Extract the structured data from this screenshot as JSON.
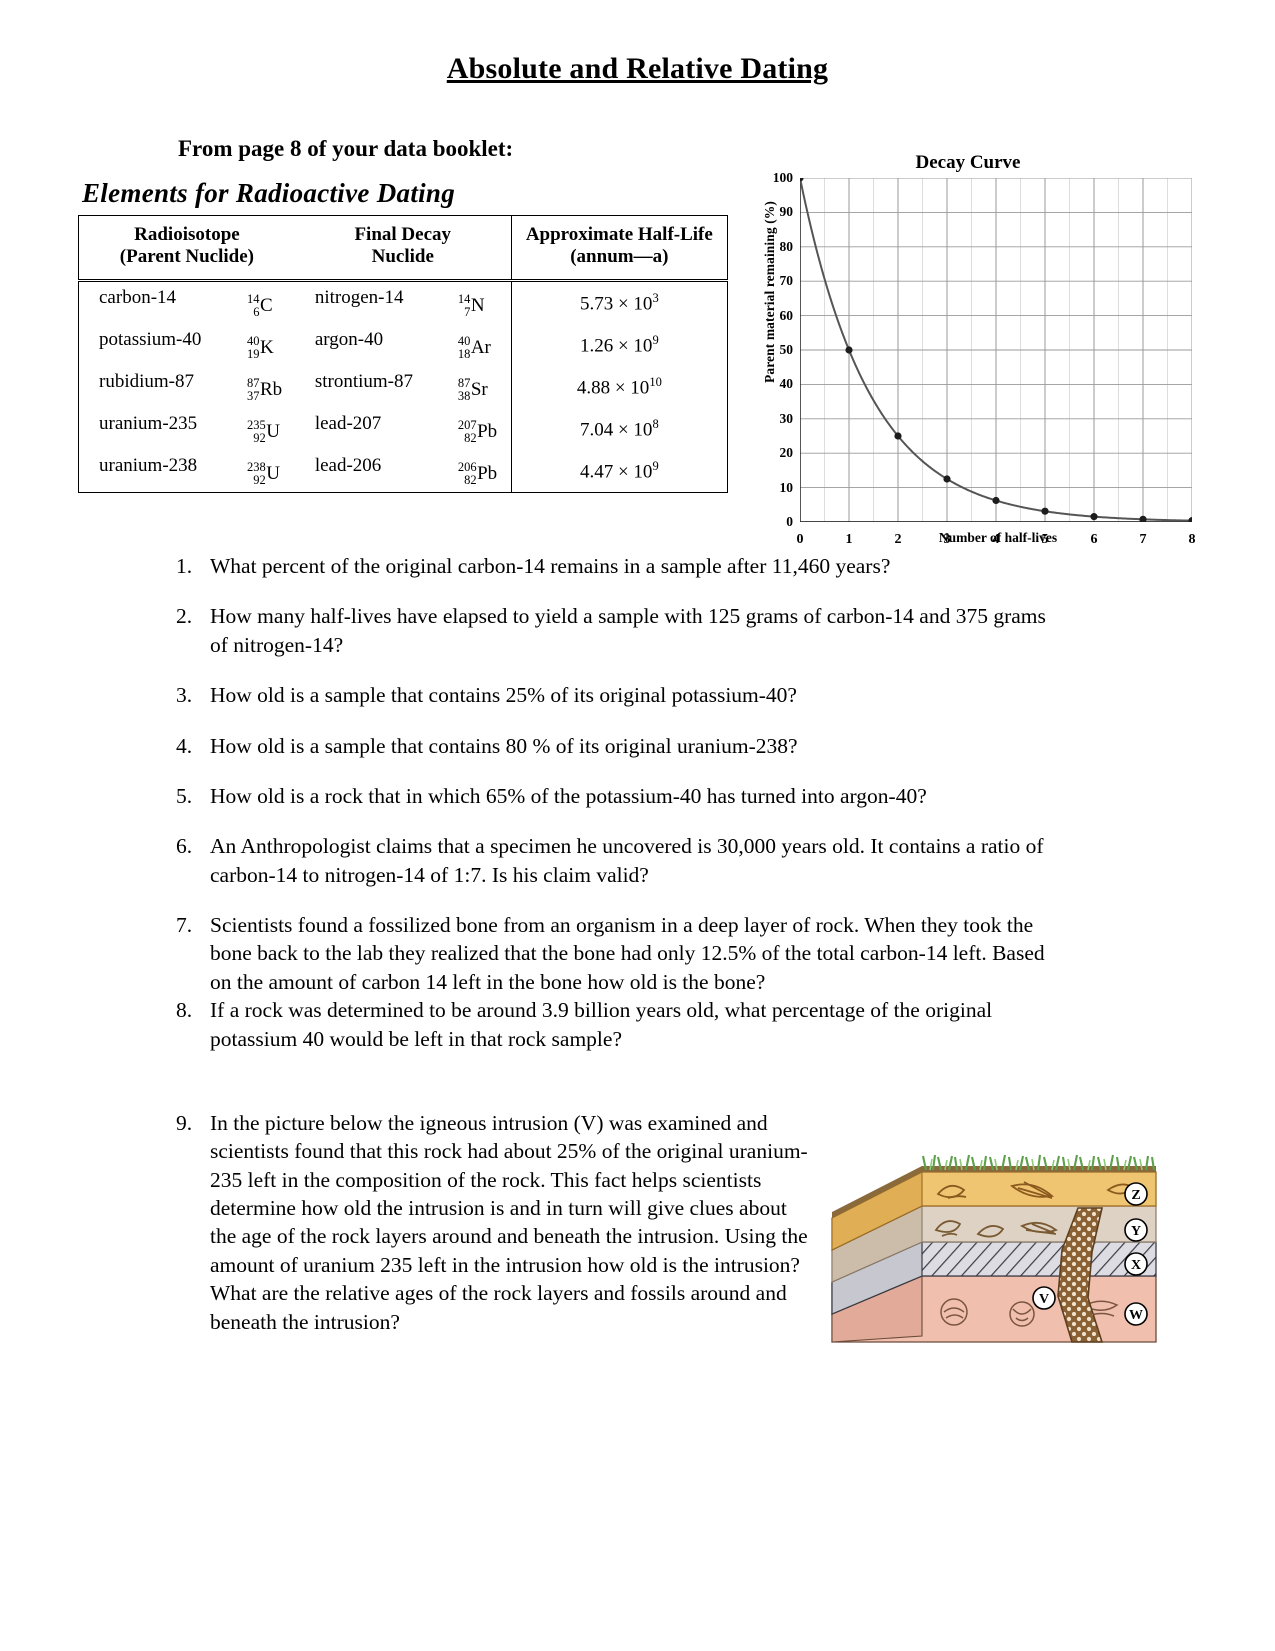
{
  "document": {
    "title": "Absolute and Relative Dating",
    "intro": "From page 8 of your data booklet:"
  },
  "booklet_table": {
    "caption": "Elements for Radioactive Dating",
    "headers": {
      "col1_line1": "Radioisotope",
      "col1_line2": "(Parent Nuclide)",
      "col2_line1": "Final Decay",
      "col2_line2": "Nuclide",
      "col3_line1": "Approximate Half-Life",
      "col3_line2": "(annum—a)"
    },
    "rows": [
      {
        "parent_name": "carbon-14",
        "parent_mass": "14",
        "parent_atomic": "6",
        "parent_symbol": "C",
        "daughter_name": "nitrogen-14",
        "daughter_mass": "14",
        "daughter_atomic": "7",
        "daughter_symbol": "N",
        "half_life_mantissa": "5.73",
        "half_life_exponent": "3",
        "half_life": "5.73 × 10³"
      },
      {
        "parent_name": "potassium-40",
        "parent_mass": "40",
        "parent_atomic": "19",
        "parent_symbol": "K",
        "daughter_name": "argon-40",
        "daughter_mass": "40",
        "daughter_atomic": "18",
        "daughter_symbol": "Ar",
        "half_life_mantissa": "1.26",
        "half_life_exponent": "9",
        "half_life": "1.26 × 10⁹"
      },
      {
        "parent_name": "rubidium-87",
        "parent_mass": "87",
        "parent_atomic": "37",
        "parent_symbol": "Rb",
        "daughter_name": "strontium-87",
        "daughter_mass": "87",
        "daughter_atomic": "38",
        "daughter_symbol": "Sr",
        "half_life_mantissa": "4.88",
        "half_life_exponent": "10",
        "half_life": "4.88 × 10¹⁰"
      },
      {
        "parent_name": "uranium-235",
        "parent_mass": "235",
        "parent_atomic": "92",
        "parent_symbol": "U",
        "daughter_name": "lead-207",
        "daughter_mass": "207",
        "daughter_atomic": "82",
        "daughter_symbol": "Pb",
        "half_life_mantissa": "7.04",
        "half_life_exponent": "8",
        "half_life": "7.04 × 10⁸"
      },
      {
        "parent_name": "uranium-238",
        "parent_mass": "238",
        "parent_atomic": "92",
        "parent_symbol": "U",
        "daughter_name": "lead-206",
        "daughter_mass": "206",
        "daughter_atomic": "82",
        "daughter_symbol": "Pb",
        "half_life_mantissa": "4.47",
        "half_life_exponent": "9",
        "half_life": "4.47 × 10⁹"
      }
    ]
  },
  "chart_data": {
    "type": "line",
    "title": "Decay Curve",
    "xlabel": "Number of half-lives",
    "ylabel": "Parent material remaining (%)",
    "x": [
      0,
      1,
      2,
      3,
      4,
      5,
      6,
      7,
      8
    ],
    "values": [
      100,
      50,
      25,
      12.5,
      6.25,
      3.13,
      1.56,
      0.78,
      0.39
    ],
    "xlim": [
      0,
      8
    ],
    "ylim": [
      0,
      100
    ],
    "xticks": [
      "0",
      "1",
      "2",
      "3",
      "4",
      "5",
      "6",
      "7",
      "8"
    ],
    "yticks": [
      "0",
      "10",
      "20",
      "30",
      "40",
      "50",
      "60",
      "70",
      "80",
      "90",
      "100"
    ],
    "grid": true,
    "minor_grid_x_divisions": 2,
    "legend": null,
    "marker": "filled-circle",
    "line_color": "#555555"
  },
  "questions": [
    {
      "number": "1.",
      "text": "What percent of the original carbon-14 remains in a sample after 11,460 years?"
    },
    {
      "number": "2.",
      "text": "How many half-lives have elapsed to yield a sample with 125 grams of carbon-14 and 375 grams of nitrogen-14?"
    },
    {
      "number": "3.",
      "text": "How old is a sample that contains 25% of its original potassium-40?"
    },
    {
      "number": "4.",
      "text": "How old is a sample that contains 80 % of its original uranium-238?"
    },
    {
      "number": "5.",
      "text": "How old is a rock that in which 65% of the potassium-40 has turned into argon-40?"
    },
    {
      "number": "6.",
      "text": "An Anthropologist claims that a specimen he uncovered is 30,000 years old.  It contains a ratio of carbon-14 to nitrogen-14 of 1:7.  Is his claim valid?"
    },
    {
      "number": "7.",
      "text": "Scientists found a fossilized bone from an organism in a deep layer of rock.  When they took the bone back to the lab they realized that the bone had only 12.5% of the total carbon-14 left.  Based on the amount of carbon 14 left in the bone how old is the bone?"
    },
    {
      "number": "8.",
      "text": "If a rock was determined to be around 3.9 billion years old, what percentage of the original potassium 40 would be left in that rock sample?"
    },
    {
      "number": "9.",
      "text": "In the picture below the igneous intrusion (V) was examined and scientists found that this rock had about 25% of the original uranium-235 left in the composition of the rock.  This fact helps scientists determine how old the intrusion is and in turn will give clues about the age of the rock layers around and beneath the intrusion. Using the amount of uranium 235 left in the intrusion how old is the intrusion?  What are the relative ages of the rock layers and fossils around and beneath the intrusion?"
    }
  ],
  "geology_figure": {
    "labels": [
      "Z",
      "Y",
      "X",
      "V",
      "W"
    ],
    "layer_colors": {
      "grass": "#7fbf6a",
      "layer_z": "#f0c571",
      "layer_y": "#ded2c4",
      "layer_x": "#d9d9de",
      "layer_w": "#f0bfae",
      "intrusion_v": "#8a6134"
    }
  }
}
